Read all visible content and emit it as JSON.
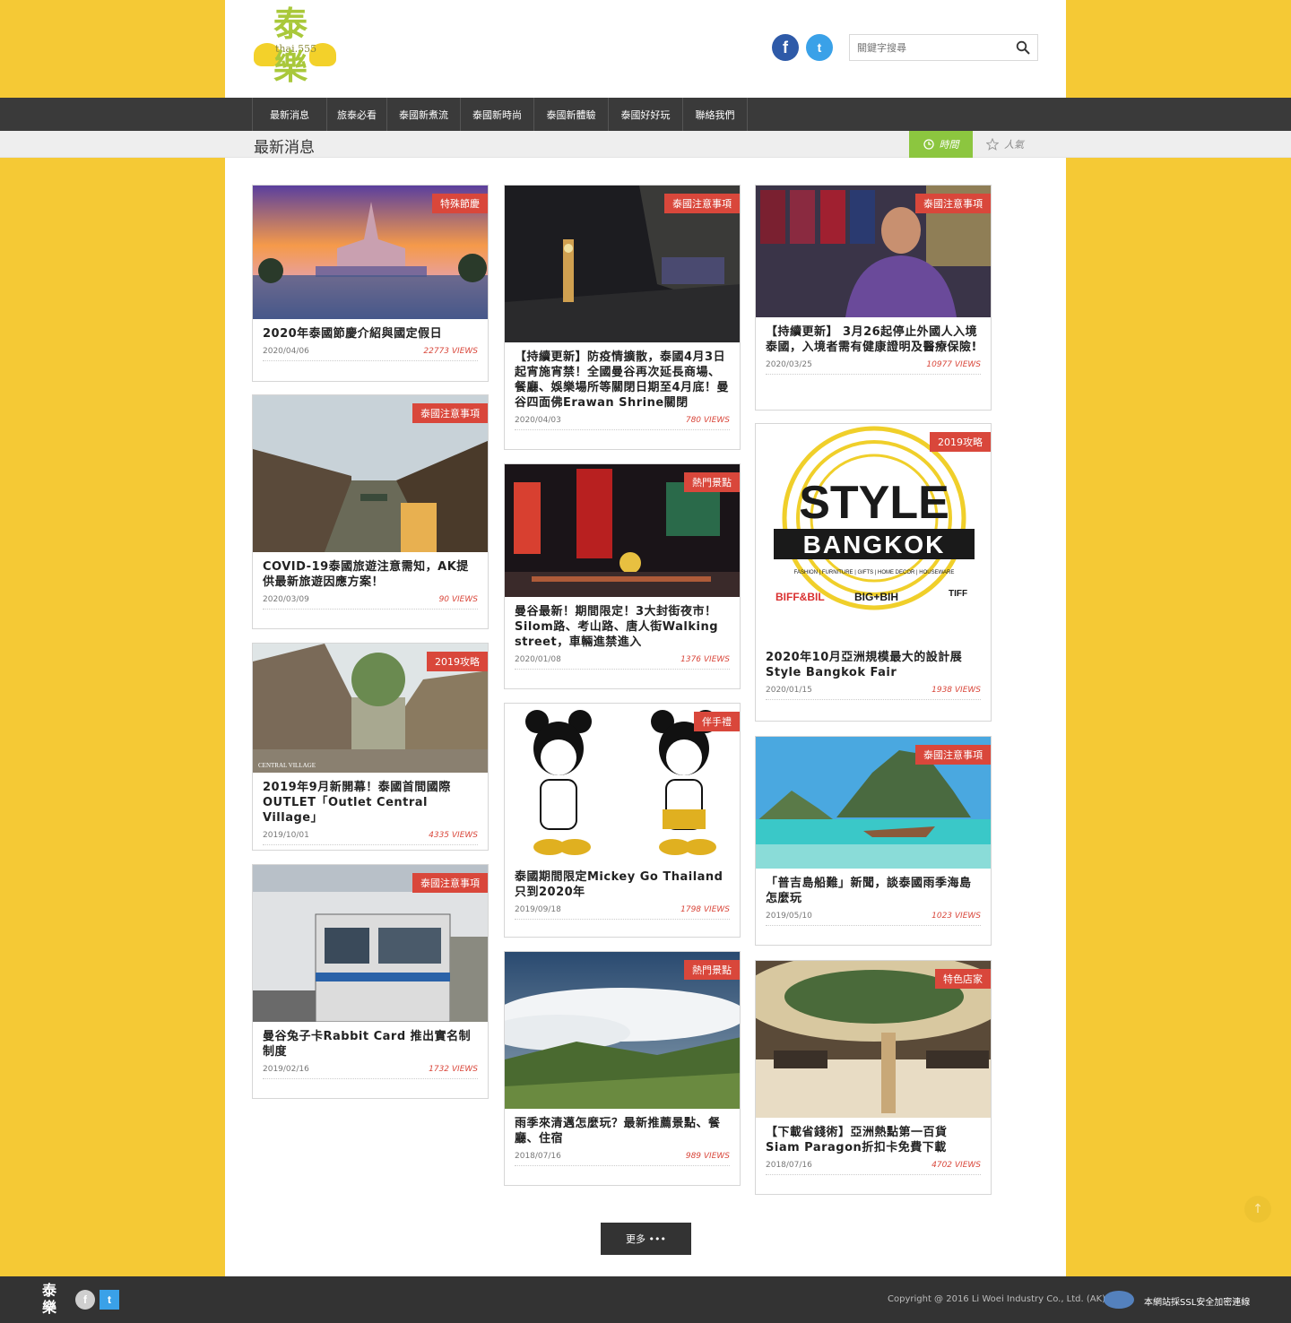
{
  "header": {
    "logo_text_top": "泰",
    "logo_text_bottom": "樂",
    "logo_sub": "thai.555",
    "facebook_icon": "f",
    "twitter_icon": "t",
    "search_placeholder": "關鍵字搜尋"
  },
  "nav": {
    "items": [
      {
        "label": "最新消息"
      },
      {
        "label": "旅泰必看"
      },
      {
        "label": "泰國新煮流"
      },
      {
        "label": "泰國新時尚"
      },
      {
        "label": "泰國新體驗"
      },
      {
        "label": "泰國好好玩"
      },
      {
        "label": "聯絡我們"
      }
    ]
  },
  "section": {
    "title": "最新消息",
    "sort_time": "時間",
    "sort_popular": "人氣"
  },
  "cards": [
    {
      "tag": "特殊節慶",
      "title": "2020年泰國節慶介紹與國定假日",
      "date": "2020/04/06",
      "views": "22773 VIEWS",
      "colors": [
        "#f5b04a",
        "#8b5aa6",
        "#3b6aa0"
      ]
    },
    {
      "tag": "泰國注意事項",
      "title": "COVID-19泰國旅遊注意需知，AK提供最新旅遊因應方案！",
      "date": "2020/03/09",
      "views": "90 VIEWS",
      "colors": [
        "#b5c0c8",
        "#6e6e60",
        "#4a5650"
      ]
    },
    {
      "tag": "2019攻略",
      "title": "2019年9月新開幕！泰國首間國際OUTLET「Outlet Central Village」",
      "date": "2019/10/01",
      "views": "4335 VIEWS",
      "colors": [
        "#c9d2d5",
        "#8a7560",
        "#3a3a30"
      ]
    },
    {
      "tag": "泰國注意事項",
      "title": "曼谷兔子卡Rabbit Card 推出實名制制度",
      "date": "2019/02/16",
      "views": "1732 VIEWS",
      "colors": [
        "#dcdcdc",
        "#7a8898",
        "#3a4048"
      ]
    },
    {
      "tag": "泰國注意事項",
      "title": "【持續更新】防疫情擴散，泰國4月3日起宵施宵禁！全國曼谷再次延長商場、餐廳、娛樂場所等關閉日期至4月底！曼谷四面佛Erawan Shrine關閉",
      "date": "2020/04/03",
      "views": "780 VIEWS",
      "colors": [
        "#222222",
        "#4a4030",
        "#1c1c1c"
      ]
    },
    {
      "tag": "熱門景點",
      "title": "曼谷最新！期間限定！3大封街夜市！Silom路、考山路、唐人街Walking street，車輛進禁進入",
      "date": "2020/01/08",
      "views": "1376 VIEWS",
      "colors": [
        "#3a1010",
        "#c8302a",
        "#201818"
      ]
    },
    {
      "tag": "伴手禮",
      "title": "泰國期間限定Mickey Go Thailand只到2020年",
      "date": "2019/09/18",
      "views": "1798 VIEWS",
      "colors": [
        "#ffffff",
        "#ffffff",
        "#ffffff"
      ]
    },
    {
      "tag": "熱門景點",
      "title": "雨季來清邁怎麼玩？最新推薦景點、餐廳、住宿",
      "date": "2018/07/16",
      "views": "989 VIEWS",
      "colors": [
        "#3a5a80",
        "#e8ecef",
        "#5a7a30"
      ]
    },
    {
      "tag": "泰國注意事項",
      "title": "【持續更新】 3月26起停止外國人入境泰國，入境者需有健康證明及醫療保險!",
      "date": "2020/03/25",
      "views": "10977 VIEWS",
      "colors": [
        "#4a4a70",
        "#7a5aa0",
        "#2a2a40"
      ]
    },
    {
      "tag": "2019攻略",
      "title": "2020年10月亞洲規模最大的設計展Style Bangkok Fair",
      "date": "2020/01/15",
      "views": "1938 VIEWS",
      "colors": [
        "#ffffff",
        "#ffffff",
        "#ffffff"
      ]
    },
    {
      "tag": "泰國注意事項",
      "title": "「普吉島船難」新聞，談泰國雨季海島怎麼玩",
      "date": "2019/05/10",
      "views": "1023 VIEWS",
      "colors": [
        "#4aa0d8",
        "#6a8a60",
        "#38c0c0"
      ]
    },
    {
      "tag": "特色店家",
      "title": "【下載省錢術】亞洲熱點第一百貨Siam Paragon折扣卡免費下載",
      "date": "2018/07/16",
      "views": "4702 VIEWS",
      "colors": [
        "#8a7050",
        "#e0d0b0",
        "#4a4030"
      ]
    }
  ],
  "style_bangkok": {
    "line1": "STYLE",
    "line2": "BANGKOK",
    "categories": "FASHION | FURNITURE | GIFTS | HOME DECOR | HOUSEWARE",
    "brand1": "BIFF&BIL",
    "brand2": "BIG+BIH",
    "brand3": "TIFF"
  },
  "outlet_sign": "CENTRAL VILLAGE",
  "more_button": "更多 •••",
  "footer": {
    "logo_top": "泰",
    "logo_bottom": "樂",
    "facebook_icon": "f",
    "twitter_icon": "t",
    "copyright": "Copyright @ 2016 Li Woei Industry Co., Ltd. (AK)",
    "ssl_text": "本網站採SSL安全加密連線"
  }
}
